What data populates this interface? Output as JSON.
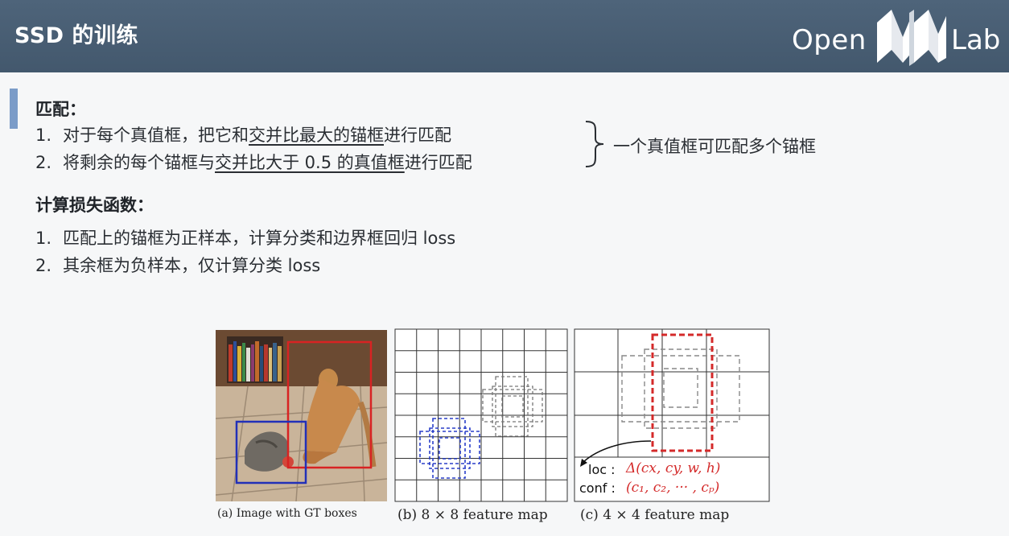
{
  "header": {
    "title": "SSD 的训练",
    "logo_left": "Open",
    "logo_right": "Lab"
  },
  "matching": {
    "heading": "匹配：",
    "items": [
      {
        "num": "1.",
        "pre": "对于每个真值框，把它和",
        "underline": "交并比最大的锚框",
        "post": "进行匹配"
      },
      {
        "num": "2.",
        "pre": "将剩余的每个锚框与",
        "underline": "交并比大于 0.5 的真值框",
        "post": "进行匹配"
      }
    ],
    "note": "一个真值框可匹配多个锚框"
  },
  "loss": {
    "heading": "计算损失函数：",
    "items": [
      {
        "num": "1.",
        "text": "匹配上的锚框为正样本，计算分类和边界框回归 loss"
      },
      {
        "num": "2.",
        "text": "其余框为负样本，仅计算分类 loss"
      }
    ]
  },
  "figure": {
    "caption_a": "(a) Image with GT boxes",
    "caption_b": "(b) 8 × 8 feature map",
    "caption_c": "(c) 4 × 4 feature map",
    "loc_label": "loc :",
    "loc_formula": "Δ(cx, cy, w, h)",
    "conf_label": "conf :",
    "conf_formula": "(c₁, c₂, ··· , cₚ)",
    "colors": {
      "gt_cat": "#2230b8",
      "gt_dog": "#d82323",
      "matched": "#d42a2a"
    }
  }
}
